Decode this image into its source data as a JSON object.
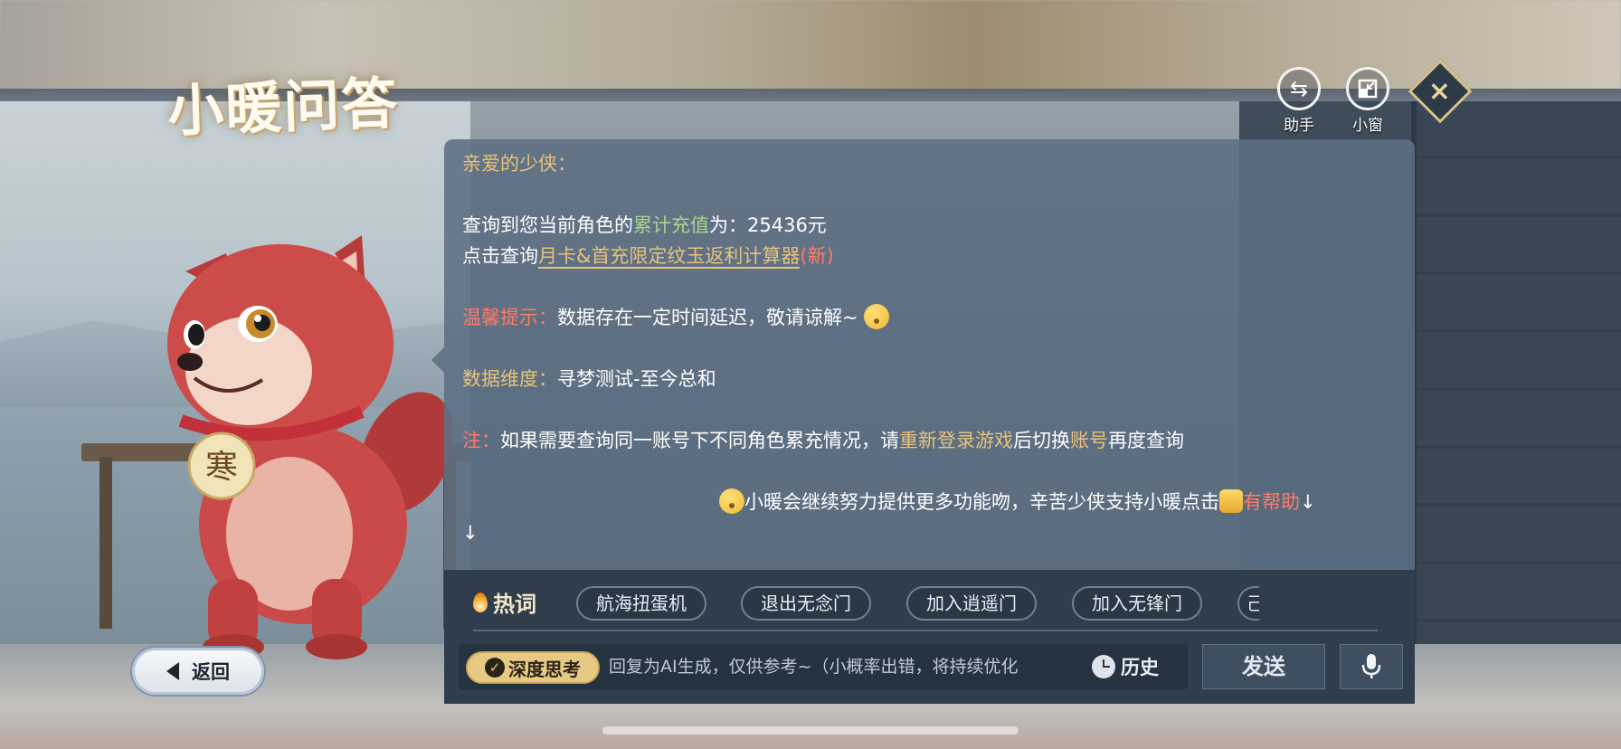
{
  "title": "小暖问答",
  "top_controls": {
    "assistant_label": "助手",
    "assistant_icon": "swap-arrows-icon",
    "window_label": "小窗",
    "window_icon": "minimize-window-icon",
    "close_icon": "close-icon"
  },
  "back_button": {
    "label": "返回"
  },
  "mascot": {
    "tag_text": "寒"
  },
  "message": {
    "greeting": "亲爱的少侠：",
    "line1_prefix": "查询到您当前角色的",
    "line1_highlight": "累计充值",
    "line1_mid": "为：",
    "line1_value": "25436元",
    "line2_prefix": "点击查询",
    "line2_link": "月卡&首充限定纹玉返利计算器",
    "line2_suffix": "(新)",
    "tip_label": "温馨提示：",
    "tip_text": "数据存在一定时间延迟，敬请谅解~",
    "dimension_label": "数据维度：",
    "dimension_text": "寻梦测试-至今总和",
    "note_label": "注：",
    "note_text1": "如果需要查询同一账号下不同角色累充情况，请",
    "note_highlight1": "重新登录游戏",
    "note_text2": "后切换",
    "note_highlight2": "账号",
    "note_text3": "再度查询",
    "feedback_text": "小暖会继续努力提供更多功能吻，辛苦少侠支持小暖点击",
    "feedback_helpful": "有帮助",
    "arrow1": "↓",
    "arrow2": "↓"
  },
  "hot_words": {
    "label": "热词",
    "items": [
      "航海扭蛋机",
      "退出无念门",
      "加入逍遥门",
      "加入无锋门",
      "己"
    ]
  },
  "input": {
    "deep_think_label": "深度思考",
    "placeholder": "回复为AI生成，仅供参考~（小概率出错，将持续优化",
    "history_label": "历史",
    "send_label": "发送"
  },
  "colors": {
    "accent_gold": "#e8c27a",
    "accent_green": "#a9d48d",
    "accent_red": "#ff7b6a",
    "panel_bg": "#5c6e82"
  }
}
